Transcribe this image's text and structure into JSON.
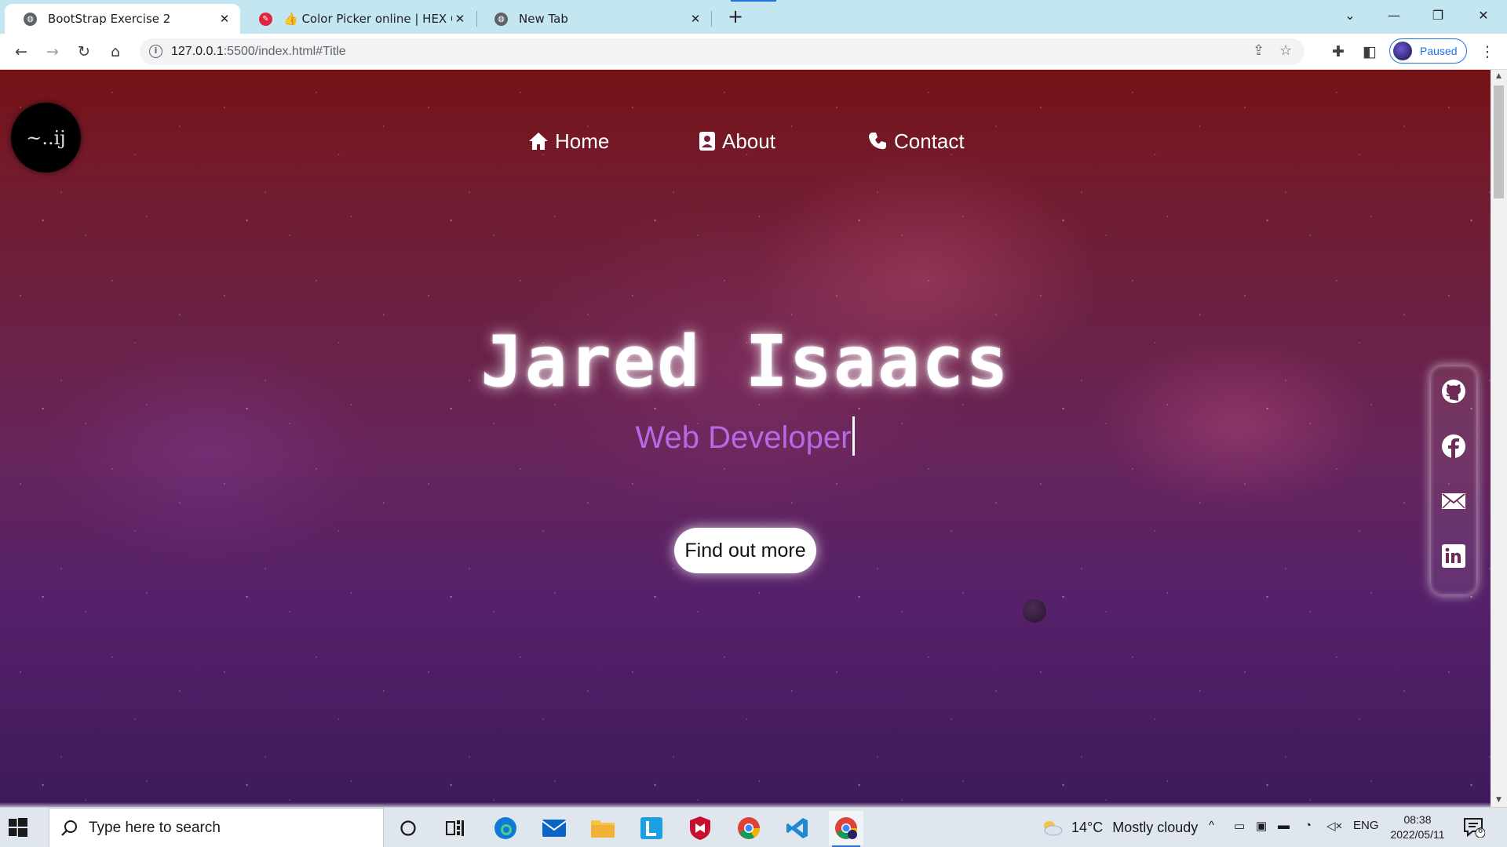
{
  "browser": {
    "tabs": [
      {
        "title": "BootStrap Exercise 2",
        "active": true
      },
      {
        "title": "👍 Color Picker online | HEX Colo",
        "active": false
      },
      {
        "title": "New Tab",
        "active": false
      }
    ],
    "new_tab": "+",
    "close": "✕",
    "url_host": "127.0.0.1",
    "url_rest": ":5500/index.html#Title",
    "profile_label": "Paused"
  },
  "site": {
    "logo_text": "~..ij",
    "nav": [
      {
        "label": "Home",
        "icon": "home-icon"
      },
      {
        "label": "About",
        "icon": "contact-card-icon"
      },
      {
        "label": "Contact",
        "icon": "phone-icon"
      }
    ],
    "hero_name": "Jared Isaacs",
    "hero_role": "Web Developer",
    "cta_label": "Find out more",
    "social": [
      "github-icon",
      "facebook-icon",
      "mail-icon",
      "linkedin-icon"
    ],
    "colors": {
      "role_text": "#b46ae6",
      "bg_top": "#741215",
      "bg_bottom": "#3d1a5c"
    }
  },
  "taskbar": {
    "search_placeholder": "Type here to search",
    "weather_temp": "14°C",
    "weather_desc": "Mostly cloudy",
    "lang": "ENG",
    "time": "08:38",
    "date": "2022/05/11",
    "notification_count": "6"
  }
}
